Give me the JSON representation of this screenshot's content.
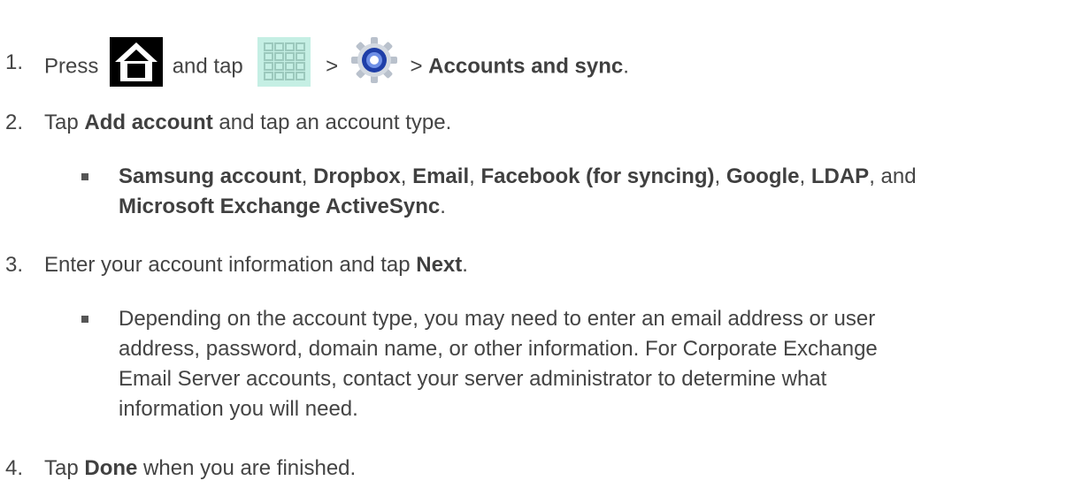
{
  "steps": [
    {
      "number": "1.",
      "press": "Press",
      "and_tap": "and tap",
      "sep1": ">",
      "sep2": ">",
      "target": "Accounts and sync",
      "end": "."
    },
    {
      "number": "2.",
      "tap": "Tap",
      "bold": "Add account",
      "rest": "and tap an account type."
    },
    {
      "number": "3.",
      "text": "Enter your account information and tap",
      "bold": "Next",
      "end": "."
    },
    {
      "number": "4.",
      "tap": "Tap",
      "bold": "Done",
      "rest": "when you are finished."
    }
  ],
  "account_types": {
    "items": [
      "Samsung account",
      "Dropbox",
      "Email",
      "Facebook (for syncing)",
      "Google",
      "LDAP"
    ],
    "separator": ",",
    "and": "and",
    "last": "Microsoft Exchange ActiveSync",
    "end": "."
  },
  "note": {
    "line1": "Depending on the account type, you may need to enter an email address or user",
    "line2": "address, password, domain name, or other information. For Corporate Exchange",
    "line3": "Email Server accounts, contact your server administrator to determine what",
    "line4": "information you will need."
  },
  "icons": {
    "home": "home-icon",
    "apps": "apps-grid-icon",
    "settings": "settings-gear-icon"
  },
  "colors": {
    "text": "#444444",
    "home_icon_bg": "#000000",
    "apps_icon_bg": "#c5efe4",
    "settings_ring": "#1f3fa8"
  }
}
